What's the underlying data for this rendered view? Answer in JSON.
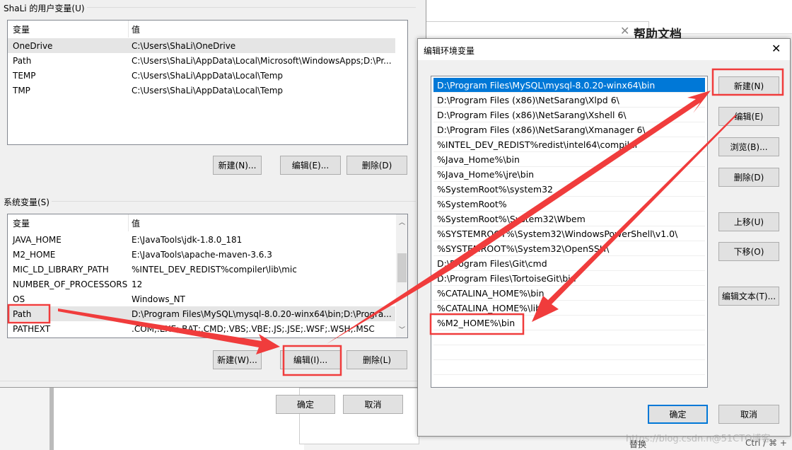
{
  "background": {
    "help_title": "帮助文档",
    "replace_label": "替换",
    "shortcut": "Ctrl / ⌘ +",
    "watermark": "https://blog.csdn.n@51CTO博客"
  },
  "env_dialog": {
    "user_group_label": "ShaLi 的用户变量(U)",
    "columns": [
      "变量",
      "值"
    ],
    "user_vars": [
      {
        "name": "OneDrive",
        "value": "C:\\Users\\ShaLi\\OneDrive"
      },
      {
        "name": "Path",
        "value": "C:\\Users\\ShaLi\\AppData\\Local\\Microsoft\\WindowsApps;D:\\Pr..."
      },
      {
        "name": "TEMP",
        "value": "C:\\Users\\ShaLi\\AppData\\Local\\Temp"
      },
      {
        "name": "TMP",
        "value": "C:\\Users\\ShaLi\\AppData\\Local\\Temp"
      }
    ],
    "user_buttons": {
      "new": "新建(N)...",
      "edit": "编辑(E)...",
      "delete": "删除(D)"
    },
    "system_group_label": "系统变量(S)",
    "system_vars": [
      {
        "name": "JAVA_HOME",
        "value": "E:\\JavaTools\\jdk-1.8.0_181"
      },
      {
        "name": "M2_HOME",
        "value": "E:\\JavaTools\\apache-maven-3.6.3"
      },
      {
        "name": "MIC_LD_LIBRARY_PATH",
        "value": "%INTEL_DEV_REDIST%compiler\\lib\\mic"
      },
      {
        "name": "NUMBER_OF_PROCESSORS",
        "value": "12"
      },
      {
        "name": "OS",
        "value": "Windows_NT"
      },
      {
        "name": "Path",
        "value": "D:\\Program Files\\MySQL\\mysql-8.0.20-winx64\\bin;D:\\Progra..."
      },
      {
        "name": "PATHEXT",
        "value": ".COM;.EXE;.BAT;.CMD;.VBS;.VBE;.JS;.JSE;.WSF;.WSH;.MSC"
      }
    ],
    "system_buttons": {
      "new": "新建(W)...",
      "edit": "编辑(I)...",
      "delete": "删除(L)"
    },
    "ok": "确定",
    "cancel": "取消"
  },
  "edit_dialog": {
    "title": "编辑环境变量",
    "entries": [
      "D:\\Program Files\\MySQL\\mysql-8.0.20-winx64\\bin",
      "D:\\Program Files (x86)\\NetSarang\\Xlpd 6\\",
      "D:\\Program Files (x86)\\NetSarang\\Xshell 6\\",
      "D:\\Program Files (x86)\\NetSarang\\Xmanager 6\\",
      "%INTEL_DEV_REDIST%redist\\intel64\\compiler",
      "%Java_Home%\\bin",
      "%Java_Home%\\jre\\bin",
      "%SystemRoot%\\system32",
      "%SystemRoot%",
      "%SystemRoot%\\System32\\Wbem",
      "%SYSTEMROOT%\\System32\\WindowsPowerShell\\v1.0\\",
      "%SYSTEMROOT%\\System32\\OpenSSH\\",
      "D:\\Program Files\\Git\\cmd",
      "D:\\Program Files\\TortoiseGit\\bin",
      "%CATALINA_HOME%\\bin",
      "%CATALINA_HOME%\\lib",
      "%M2_HOME%\\bin"
    ],
    "selected_index": 0,
    "buttons": {
      "new": "新建(N)",
      "edit": "编辑(E)",
      "browse": "浏览(B)...",
      "delete": "删除(D)",
      "up": "上移(U)",
      "down": "下移(O)",
      "edit_text": "编辑文本(T)..."
    },
    "ok": "确定",
    "cancel": "取消"
  },
  "colors": {
    "selection": "#0078d7",
    "annotation": "#f03c3c"
  }
}
